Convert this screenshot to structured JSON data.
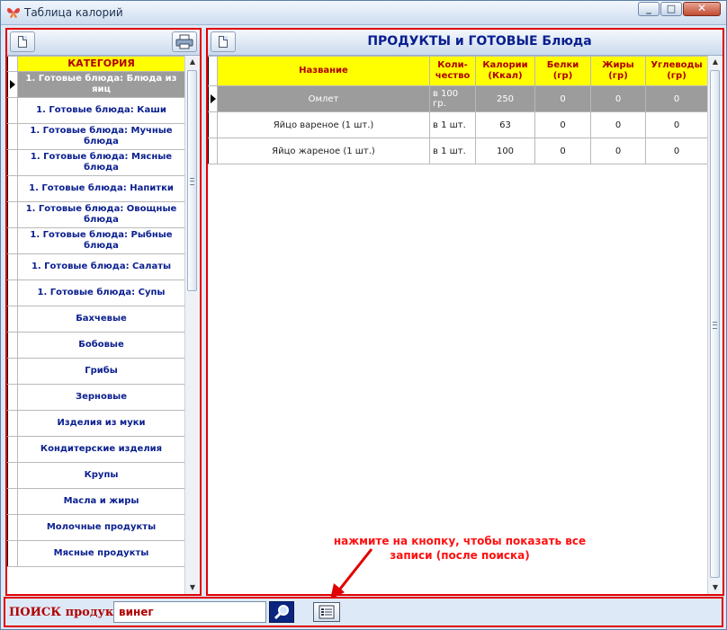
{
  "window": {
    "title": "Таблица калорий"
  },
  "left_panel": {
    "header": "КАТЕГОРИЯ",
    "categories": [
      "1. Готовые блюда: Блюда из яиц",
      "1. Готовые блюда: Каши",
      "1. Готовые блюда: Мучные блюда",
      "1. Готовые блюда: Мясные блюда",
      "1. Готовые блюда: Напитки",
      "1. Готовые блюда: Овощные блюда",
      "1. Готовые блюда: Рыбные блюда",
      "1. Готовые блюда: Салаты",
      "1. Готовые блюда: Супы",
      "Бахчевые",
      "Бобовые",
      "Грибы",
      "Зерновые",
      "Изделия из муки",
      "Кондитерские изделия",
      "Крупы",
      "Масла и жиры",
      "Молочные продукты",
      "Мясные продукты"
    ]
  },
  "right_panel": {
    "title": "ПРОДУКТЫ и ГОТОВЫЕ Блюда",
    "columns": [
      "Название",
      "Коли-чество",
      "Калории (Ккал)",
      "Белки (гр)",
      "Жиры (гр)",
      "Углеводы (гр)"
    ],
    "rows": [
      [
        "Омлет",
        "в 100 гр.",
        "250",
        "0",
        "0",
        "0"
      ],
      [
        "Яйцо вареное (1 шт.)",
        "в 1 шт.",
        "63",
        "0",
        "0",
        "0"
      ],
      [
        "Яйцо жареное (1 шт.)",
        "в 1 шт.",
        "100",
        "0",
        "0",
        "0"
      ]
    ]
  },
  "annotation": {
    "line1": "нажмите на кнопку, чтобы показать все",
    "line2": "записи (после поиска)"
  },
  "search": {
    "label": "ПОИСК продукта:",
    "value": "винег"
  }
}
